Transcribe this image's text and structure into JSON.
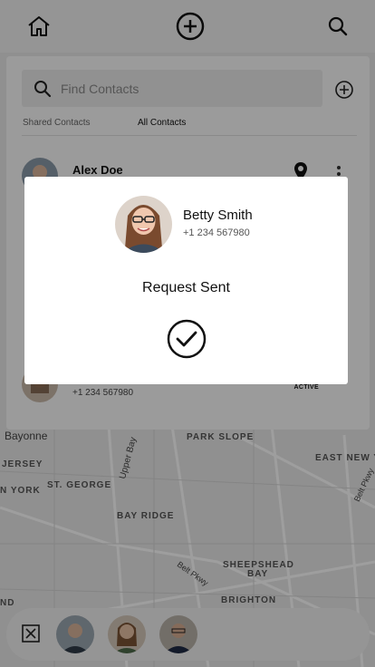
{
  "header": {
    "home_icon": "home-icon",
    "add_icon": "plus-circle-icon",
    "search_icon": "search-icon"
  },
  "contacts": {
    "search_placeholder": "Find Contacts",
    "tabs": [
      {
        "label": "Shared Contacts",
        "active": false
      },
      {
        "label": "All Contacts",
        "active": true
      }
    ],
    "rows": [
      {
        "name": "Alex Doe",
        "phone": "",
        "status": ""
      },
      {
        "name": "",
        "phone": "+1 234 567980",
        "status": "ACTIVE"
      }
    ]
  },
  "map_labels": [
    "Bayonne",
    "PARK SLOPE",
    "EAST NEW Y",
    "JERSEY",
    "ST. GEORGE",
    "Upper Bay",
    "N YORK",
    "BAY RIDGE",
    "SHEEPSHEAD",
    "BAY",
    "BRIGHTON",
    "Belt Pkwy",
    "Belt Pkwy",
    "ND"
  ],
  "modal": {
    "name": "Betty Smith",
    "phone": "+1 234 567980",
    "message": "Request Sent",
    "icon": "check-circle-icon"
  },
  "colors": {
    "overlay": "#000000",
    "map": "#e8e8e8",
    "panel": "#fbfbfb"
  }
}
